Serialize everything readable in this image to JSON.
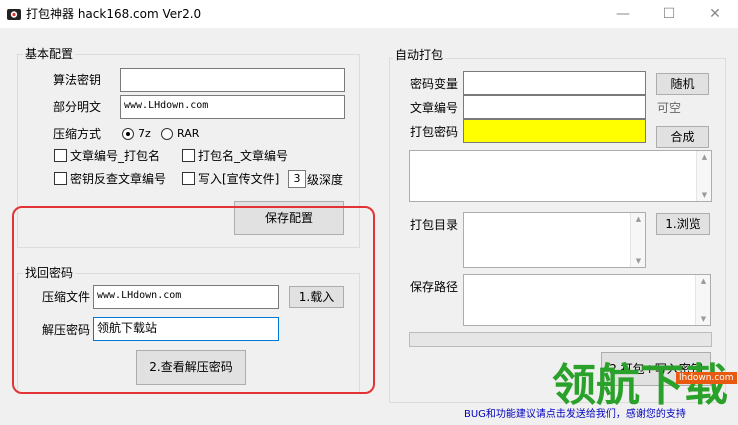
{
  "window": {
    "title": "打包神器 hack168.com Ver2.0",
    "controls": {
      "minimize": "—",
      "maximize": "☐",
      "close": "✕"
    }
  },
  "basic_config": {
    "legend": "基本配置",
    "algo_key_label": "算法密钥",
    "algo_key_value": "",
    "plaintext_label": "部分明文",
    "plaintext_value": "www.LHdown.com",
    "compress_label": "压缩方式",
    "radio_7z": "7z",
    "radio_rar": "RAR",
    "selected_compression": "7z",
    "chk_article_pack": "文章编号_打包名",
    "chk_pack_article": "打包名_文章编号",
    "chk_key_lookup": "密钥反查文章编号",
    "chk_write_promo": "写入[宣传文件]",
    "depth_value": "3",
    "depth_label": "级深度",
    "save_button": "保存配置"
  },
  "recover": {
    "legend": "找回密码",
    "file_label": "压缩文件",
    "file_value": "www.LHdown.com",
    "load_button": "1.载入",
    "pwd_label": "解压密码",
    "pwd_value": "领航下载站",
    "view_button": "2.查看解压密码"
  },
  "auto_pack": {
    "legend": "自动打包",
    "pwd_var_label": "密码变量",
    "pwd_var_value": "",
    "random_button": "随机",
    "article_no_label": "文章编号",
    "article_no_value": "",
    "optional_hint": "可空",
    "pack_pwd_label": "打包密码",
    "pack_pwd_value": "",
    "combine_button": "合成",
    "pack_dir_label": "打包目录",
    "browse_button": "1.浏览",
    "save_path_label": "保存路径",
    "pack_button": "2.打包+写入密钥"
  },
  "footer_text": "BUG和功能建议请点击发送给我们，感谢您的支持",
  "watermark": {
    "text": "领航下载",
    "site": "lhdown.com"
  },
  "colors": {
    "highlight": "#ffff00",
    "annotation": "#e23434",
    "footer": "#0000c0",
    "watermark": "#2aa12a"
  }
}
